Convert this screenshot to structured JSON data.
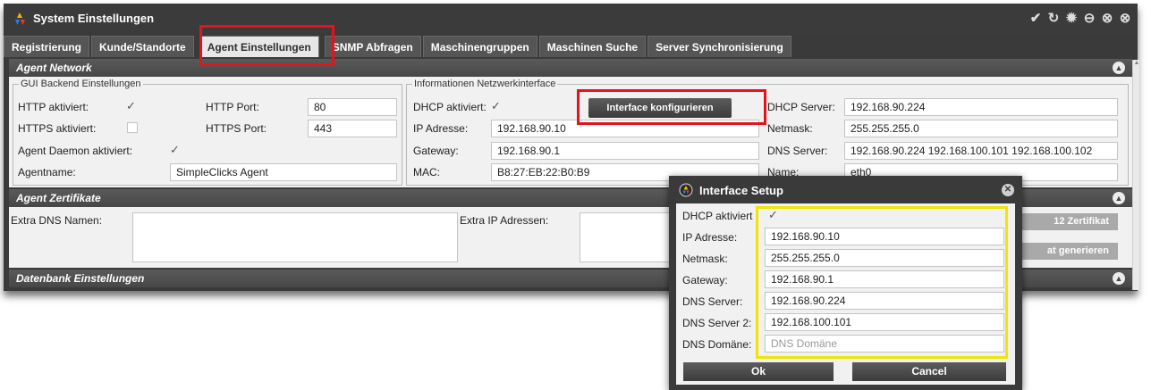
{
  "window": {
    "title": "System Einstellungen",
    "controls": [
      "check-icon",
      "refresh-icon",
      "settings-icon",
      "minimize-icon",
      "restore-icon",
      "close-icon"
    ]
  },
  "tabs": [
    {
      "label": "Registrierung"
    },
    {
      "label": "Kunde/Standorte"
    },
    {
      "label": "Agent Einstellungen",
      "active": true
    },
    {
      "label": "SNMP Abfragen"
    },
    {
      "label": "Maschinengruppen"
    },
    {
      "label": "Maschinen Suche"
    },
    {
      "label": "Server Synchronisierung"
    }
  ],
  "agent_network": {
    "title": "Agent Network",
    "gui_backend": {
      "legend": "GUI Backend Einstellungen",
      "http_enabled_label": "HTTP aktiviert:",
      "https_enabled_label": "HTTPS aktiviert:",
      "http_port_label": "HTTP Port:",
      "http_port_value": "80",
      "https_port_label": "HTTPS Port:",
      "https_port_value": "443",
      "daemon_label": "Agent Daemon aktiviert:",
      "agentname_label": "Agentname:",
      "agentname_value": "SimpleClicks Agent"
    },
    "netinfo": {
      "legend": "Informationen Netzwerkinterface",
      "dhcp_label": "DHCP aktiviert:",
      "configure_button": "Interface konfigurieren",
      "ip_label": "IP Adresse:",
      "ip_value": "192.168.90.10",
      "gateway_label": "Gateway:",
      "gateway_value": "192.168.90.1",
      "mac_label": "MAC:",
      "mac_value": "B8:27:EB:22:B0:B9",
      "dhcp_server_label": "DHCP Server:",
      "dhcp_server_value": "192.168.90.224",
      "netmask_label": "Netmask:",
      "netmask_value": "255.255.255.0",
      "dns_server_label": "DNS Server:",
      "dns_server_value": "192.168.90.224 192.168.100.101 192.168.100.102",
      "name_label": "Name:",
      "name_value": "eth0"
    }
  },
  "agent_cert": {
    "title": "Agent Zertifikate",
    "extra_dns_label": "Extra DNS Namen:",
    "extra_ip_label": "Extra IP Adressen:",
    "btn_zertifikat": "12 Zertifikat",
    "btn_generieren": "at generieren"
  },
  "db_settings": {
    "title": "Datenbank Einstellungen"
  },
  "dialog": {
    "title": "Interface Setup",
    "dhcp_label": "DHCP aktiviert",
    "ip_label": "IP Adresse:",
    "ip_value": "192.168.90.10",
    "netmask_label": "Netmask:",
    "netmask_value": "255.255.255.0",
    "gateway_label": "Gateway:",
    "gateway_value": "192.168.90.1",
    "dns1_label": "DNS Server:",
    "dns1_value": "192.168.90.224",
    "dns2_label": "DNS Server 2:",
    "dns2_value": "192.168.100.101",
    "domain_label": "DNS Domäne:",
    "domain_placeholder": "DNS Domäne",
    "ok_label": "Ok",
    "cancel_label": "Cancel"
  },
  "colors": {
    "highlight_red": "#e3141b",
    "highlight_yellow": "#f2e500",
    "chrome_dark": "#3a3a3a"
  }
}
